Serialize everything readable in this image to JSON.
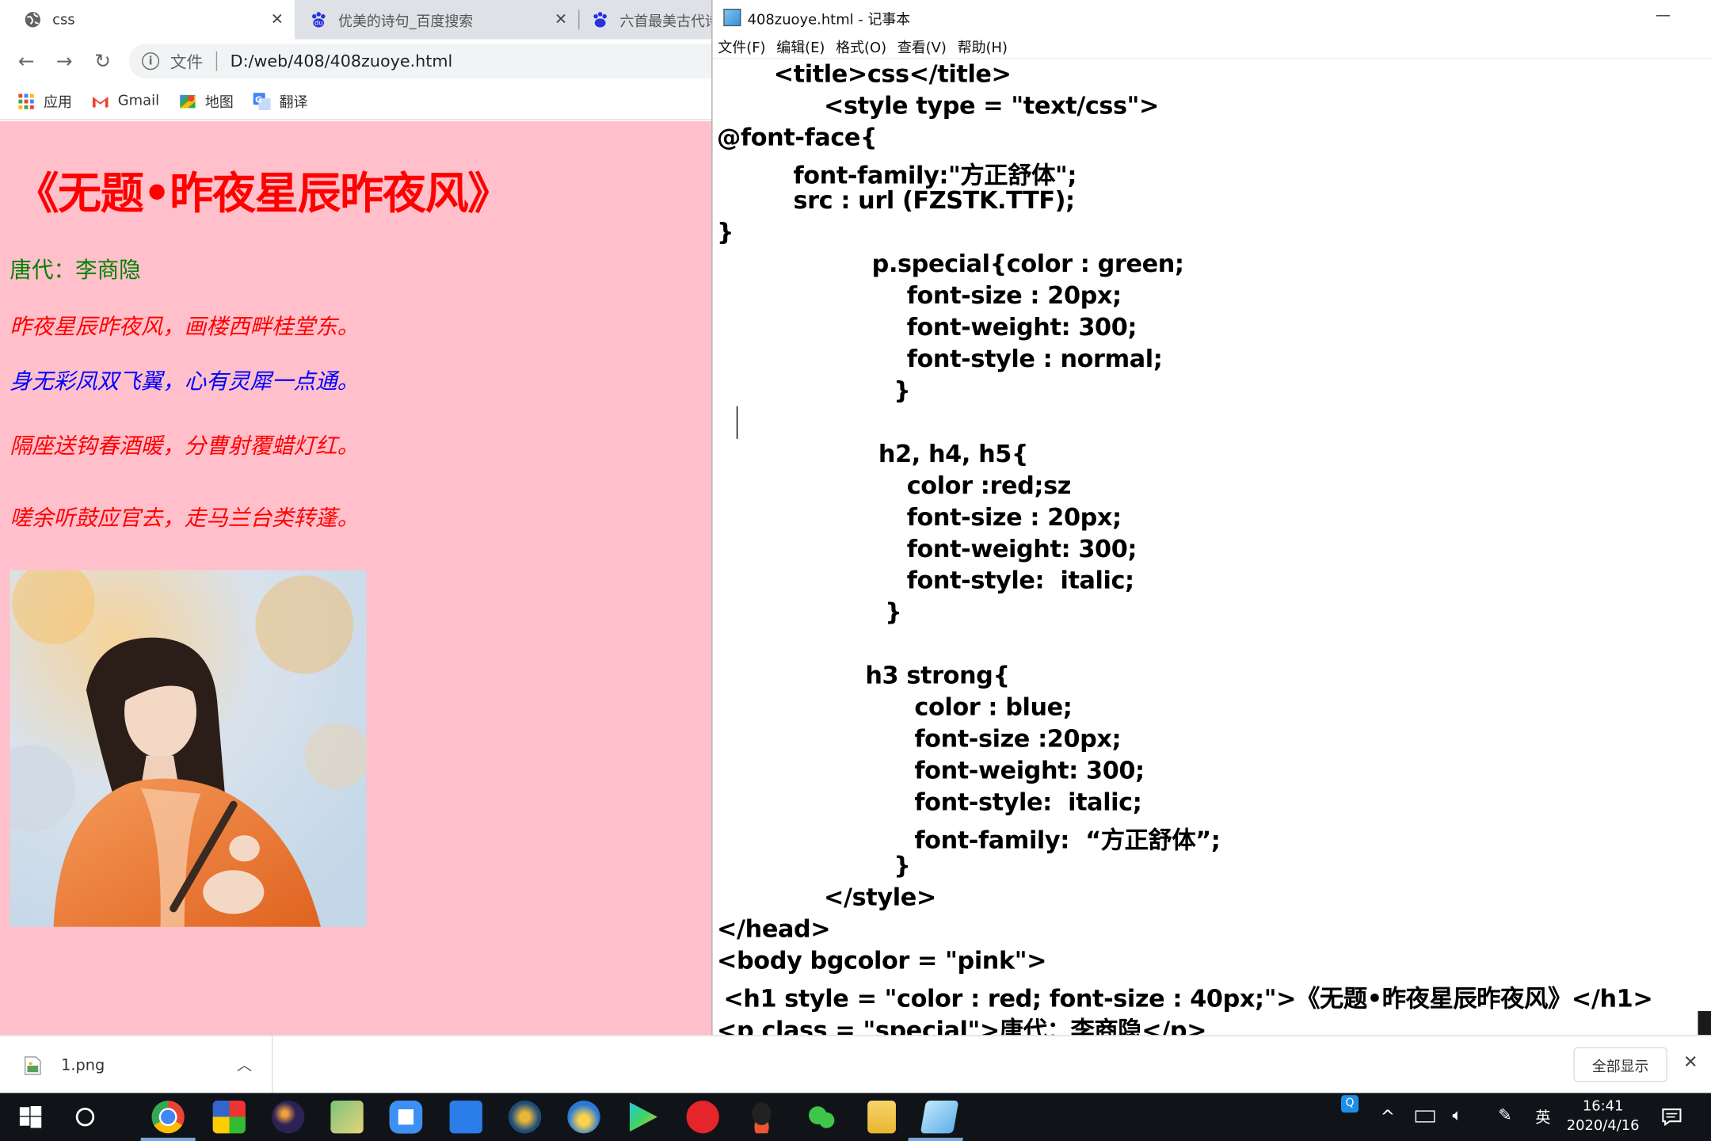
{
  "browser": {
    "tabs": [
      {
        "title": "css"
      },
      {
        "title": "优美的诗句_百度搜索"
      },
      {
        "title": "六首最美古代诗"
      }
    ],
    "scheme_label": "文件",
    "url": "D:/web/408/408zuoye.html",
    "bookmarks": [
      {
        "label": "应用"
      },
      {
        "label": "Gmail"
      },
      {
        "label": "地图"
      },
      {
        "label": "翻译"
      }
    ]
  },
  "page": {
    "heading": "《无题•昨夜星辰昨夜风》",
    "author": "唐代：李商隐",
    "lines": [
      {
        "text": "昨夜星辰昨夜风，画楼西畔桂堂东。",
        "color": "#ff0000"
      },
      {
        "text": "身无彩凤双飞翼，心有灵犀一点通。",
        "color": "#0000ff"
      },
      {
        "text": "隔座送钩春酒暖，分曹射覆蜡灯红。",
        "color": "#ff0000"
      },
      {
        "text": "嗟余听鼓应官去，走马兰台类转蓬。",
        "color": "#ff0000"
      }
    ],
    "background": "#ffc0cb"
  },
  "notepad": {
    "title": "408zuoye.html - 记事本",
    "menu": [
      "文件(F)",
      "编辑(E)",
      "格式(O)",
      "查看(V)",
      "帮助(H)"
    ],
    "code_lines": [
      "<title>css</title>",
      "<style type = \"text/css\">",
      "@font-face{",
      "font-family:\"方正舒体\";",
      "src : url (FZSTK.TTF);",
      "}",
      "p.special{color : green;",
      "font-size : 20px;",
      "font-weight: 300;",
      "font-style : normal;",
      "}",
      "h2, h4, h5{",
      "color :red;sz",
      "font-size : 20px;",
      "font-weight: 300;",
      "font-style:  italic;",
      "}",
      "h3 strong{",
      "color : blue;",
      "font-size :20px;",
      "font-weight: 300;",
      "font-style:  italic;",
      "font-family:  “方正舒体”;",
      "}",
      "</style>",
      "</head>",
      "<body bgcolor = \"pink\">",
      "<h1 style = \"color : red; font-size : 40px;\">《无题•昨夜星辰昨夜风》</h1>",
      "<p class = \"special\">唐代：李商隐</p>"
    ]
  },
  "downloads": {
    "file": "1.png",
    "show_all": "全部显示"
  },
  "taskbar": {
    "ime": "英",
    "time": "16:41",
    "date": "2020/4/16"
  }
}
